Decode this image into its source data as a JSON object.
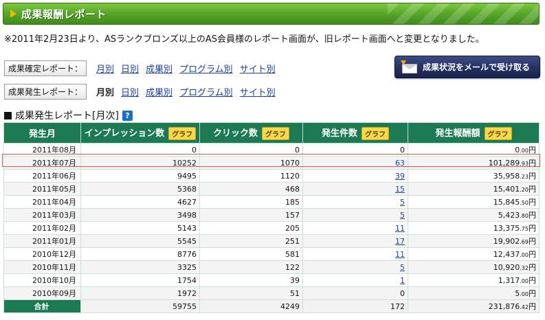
{
  "title": "成果報酬レポート",
  "notice": "※2011年2月23日より、ASランクブロンズ以上のAS会員様のレポート画面が、旧レポート画面へと変更となりました。",
  "confirmed_report": {
    "label": "成果確定レポート：",
    "links": [
      "月別",
      "日別",
      "成果別",
      "プログラム別",
      "サイト別"
    ]
  },
  "occurred_report": {
    "label": "成果発生レポート：",
    "links": [
      "月別",
      "日別",
      "成果別",
      "プログラム別",
      "サイト別"
    ],
    "active": "月別"
  },
  "mail_button": "成果状況をメールで受け取る",
  "section_title": "成果発生レポート[月次]",
  "help_icon": "?",
  "table": {
    "headers": [
      "発生月",
      "インプレッション数",
      "クリック数",
      "発生件数",
      "発生報酬額"
    ],
    "graph_label": "グラフ",
    "rows": [
      {
        "month": "2011年08月",
        "impressions": "0",
        "clicks": "0",
        "count": "0",
        "count_link": false,
        "reward_main": "0",
        "reward_dec": ".00",
        "yen": "円"
      },
      {
        "month": "2011年07月",
        "impressions": "10252",
        "clicks": "1070",
        "count": "63",
        "count_link": true,
        "reward_main": "101,289",
        "reward_dec": ".93",
        "yen": "円"
      },
      {
        "month": "2011年06月",
        "impressions": "9495",
        "clicks": "1120",
        "count": "39",
        "count_link": true,
        "reward_main": "35,958",
        "reward_dec": ".23",
        "yen": "円"
      },
      {
        "month": "2011年05月",
        "impressions": "5368",
        "clicks": "468",
        "count": "15",
        "count_link": true,
        "reward_main": "15,401",
        "reward_dec": ".20",
        "yen": "円"
      },
      {
        "month": "2011年04月",
        "impressions": "4627",
        "clicks": "185",
        "count": "5",
        "count_link": true,
        "reward_main": "15,845",
        "reward_dec": ".50",
        "yen": "円"
      },
      {
        "month": "2011年03月",
        "impressions": "3498",
        "clicks": "157",
        "count": "5",
        "count_link": true,
        "reward_main": "5,423",
        "reward_dec": ".80",
        "yen": "円"
      },
      {
        "month": "2011年02月",
        "impressions": "5143",
        "clicks": "205",
        "count": "11",
        "count_link": true,
        "reward_main": "13,375",
        "reward_dec": ".75",
        "yen": "円"
      },
      {
        "month": "2011年01月",
        "impressions": "5545",
        "clicks": "251",
        "count": "17",
        "count_link": true,
        "reward_main": "19,902",
        "reward_dec": ".69",
        "yen": "円"
      },
      {
        "month": "2010年12月",
        "impressions": "8776",
        "clicks": "581",
        "count": "11",
        "count_link": true,
        "reward_main": "12,437",
        "reward_dec": ".00",
        "yen": "円"
      },
      {
        "month": "2010年11月",
        "impressions": "3325",
        "clicks": "122",
        "count": "5",
        "count_link": true,
        "reward_main": "10,920",
        "reward_dec": ".32",
        "yen": "円"
      },
      {
        "month": "2010年10月",
        "impressions": "1754",
        "clicks": "39",
        "count": "1",
        "count_link": true,
        "reward_main": "1,317",
        "reward_dec": ".00",
        "yen": "円"
      },
      {
        "month": "2010年09月",
        "impressions": "1972",
        "clicks": "51",
        "count": "0",
        "count_link": false,
        "reward_main": "5",
        "reward_dec": ".00",
        "yen": "円"
      }
    ],
    "total": {
      "label": "合計",
      "impressions": "59755",
      "clicks": "4249",
      "count": "172",
      "reward_main": "231,876",
      "reward_dec": ".42",
      "yen": "円"
    }
  },
  "colors": {
    "header_green": "#1c7a52",
    "title_green": "#5aa82a",
    "link_blue": "#1a3fa8",
    "graph_yellow": "#f6d84a",
    "highlight_red": "#d9534f"
  }
}
